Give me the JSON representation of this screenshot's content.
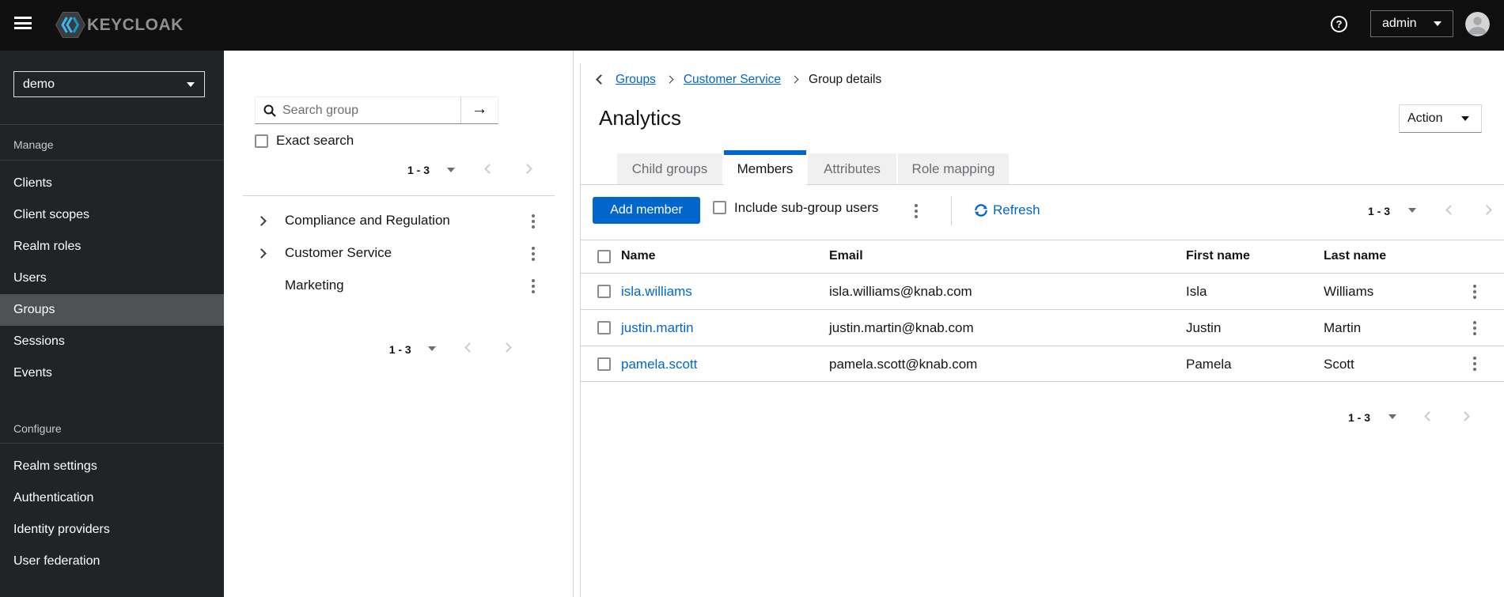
{
  "masthead": {
    "logo_text": "KEYCLOAK",
    "help": "?",
    "user": "admin"
  },
  "sidebar": {
    "realm": "demo",
    "sections": [
      {
        "label": "Manage",
        "items": [
          {
            "label": "Clients"
          },
          {
            "label": "Client scopes"
          },
          {
            "label": "Realm roles"
          },
          {
            "label": "Users"
          },
          {
            "label": "Groups",
            "selected": true
          },
          {
            "label": "Sessions"
          },
          {
            "label": "Events"
          }
        ]
      },
      {
        "label": "Configure",
        "items": [
          {
            "label": "Realm settings"
          },
          {
            "label": "Authentication"
          },
          {
            "label": "Identity providers"
          },
          {
            "label": "User federation"
          }
        ]
      }
    ]
  },
  "tree": {
    "search_placeholder": "Search group",
    "submit_arrow": "→",
    "exact_label": "Exact search",
    "pagination_top": "1 - 3",
    "groups": [
      {
        "name": "Compliance and Regulation"
      },
      {
        "name": "Customer Service"
      },
      {
        "name": "Marketing"
      }
    ],
    "pagination_bottom": "1 - 3"
  },
  "main": {
    "breadcrumb": {
      "groups": "Groups",
      "parent": "Customer Service",
      "current": "Group details"
    },
    "title": "Analytics",
    "action_label": "Action",
    "tabs": [
      {
        "label": "Child groups"
      },
      {
        "label": "Members"
      },
      {
        "label": "Attributes"
      },
      {
        "label": "Role mapping"
      }
    ],
    "toolbar": {
      "add_member": "Add member",
      "include_label": "Include sub-group users",
      "refresh": "Refresh",
      "pagination": "1 - 3"
    },
    "table": {
      "columns": [
        "Name",
        "Email",
        "First name",
        "Last name"
      ],
      "rows": [
        {
          "name": "isla.williams",
          "email": "isla.williams@knab.com",
          "first": "Isla",
          "last": "Williams"
        },
        {
          "name": "justin.martin",
          "email": "justin.martin@knab.com",
          "first": "Justin",
          "last": "Martin"
        },
        {
          "name": "pamela.scott",
          "email": "pamela.scott@knab.com",
          "first": "Pamela",
          "last": "Scott"
        }
      ]
    },
    "pagination_bottom": "1 - 3"
  },
  "colors": {
    "accent": "#0066cc",
    "link": "#0066cc",
    "masthead_bg": "#0f0f0f",
    "sidebar_bg": "#212427",
    "sidebar_selected": "#4f5255",
    "border": "#d2d2d2",
    "text": "#151515",
    "muted": "#6a6e73",
    "tab_bg": "#f0f0f0",
    "logo_blue": "#3cb9ec"
  }
}
